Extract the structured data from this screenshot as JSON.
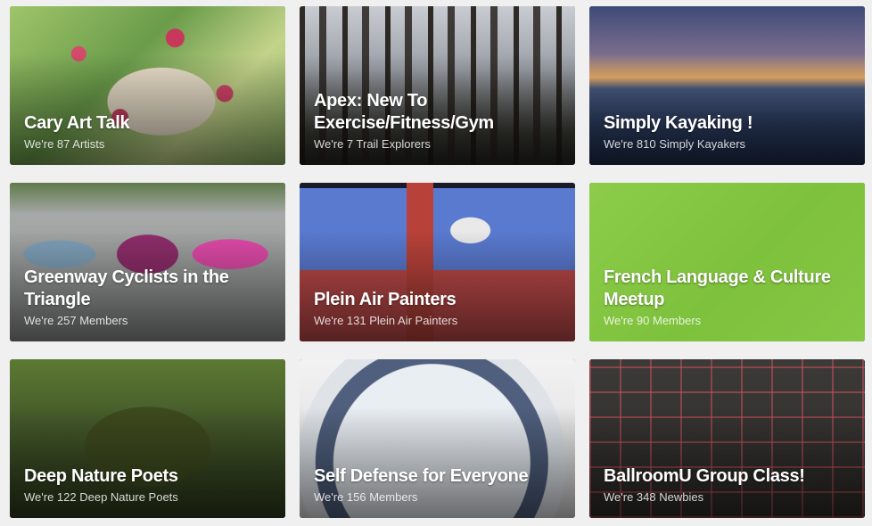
{
  "groups": [
    {
      "title": "Cary Art Talk",
      "count": "We're 87 Artists"
    },
    {
      "title": "Apex: New To Exercise/Fitness/Gym",
      "count": "We're 7 Trail Explorers"
    },
    {
      "title": "Simply Kayaking !",
      "count": "We're 810 Simply Kayakers"
    },
    {
      "title": "Greenway Cyclists in the Triangle",
      "count": "We're 257 Members"
    },
    {
      "title": "Plein Air Painters",
      "count": "We're 131 Plein Air Painters"
    },
    {
      "title": "French Language & Culture Meetup",
      "count": "We're 90 Members"
    },
    {
      "title": "Deep Nature Poets",
      "count": "We're 122 Deep Nature Poets"
    },
    {
      "title": "Self Defense for Everyone",
      "count": "We're 156 Members"
    },
    {
      "title": "BallroomU Group Class!",
      "count": "We're 348 Newbies"
    }
  ],
  "colors": {
    "french_card": "#7ec13c"
  }
}
